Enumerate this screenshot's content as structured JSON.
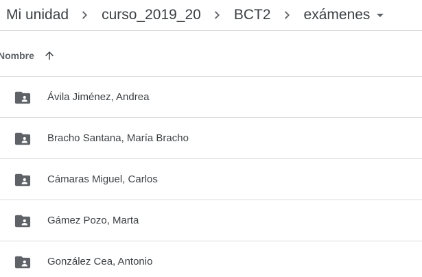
{
  "breadcrumb": {
    "items": [
      {
        "label": "Mi unidad"
      },
      {
        "label": "curso_2019_20"
      },
      {
        "label": "BCT2"
      },
      {
        "label": "exámenes"
      }
    ],
    "separator_icon": "chevron-right-icon",
    "dropdown_icon": "caret-down-icon"
  },
  "header": {
    "name_label": "Nombre",
    "sort_icon": "arrow-up-icon",
    "sort_direction": "ascending"
  },
  "files": [
    {
      "name": "Ávila Jiménez, Andrea",
      "icon": "shared-folder-icon"
    },
    {
      "name": "Bracho Santana, María Bracho",
      "icon": "shared-folder-icon"
    },
    {
      "name": "Cámaras Miguel, Carlos",
      "icon": "shared-folder-icon"
    },
    {
      "name": "Gámez Pozo, Marta",
      "icon": "shared-folder-icon"
    },
    {
      "name": "González Cea, Antonio",
      "icon": "shared-folder-icon"
    }
  ],
  "colors": {
    "text": "#3c4043",
    "muted": "#5f6368",
    "divider": "#dadce0",
    "folder_icon": "#5f6368"
  }
}
